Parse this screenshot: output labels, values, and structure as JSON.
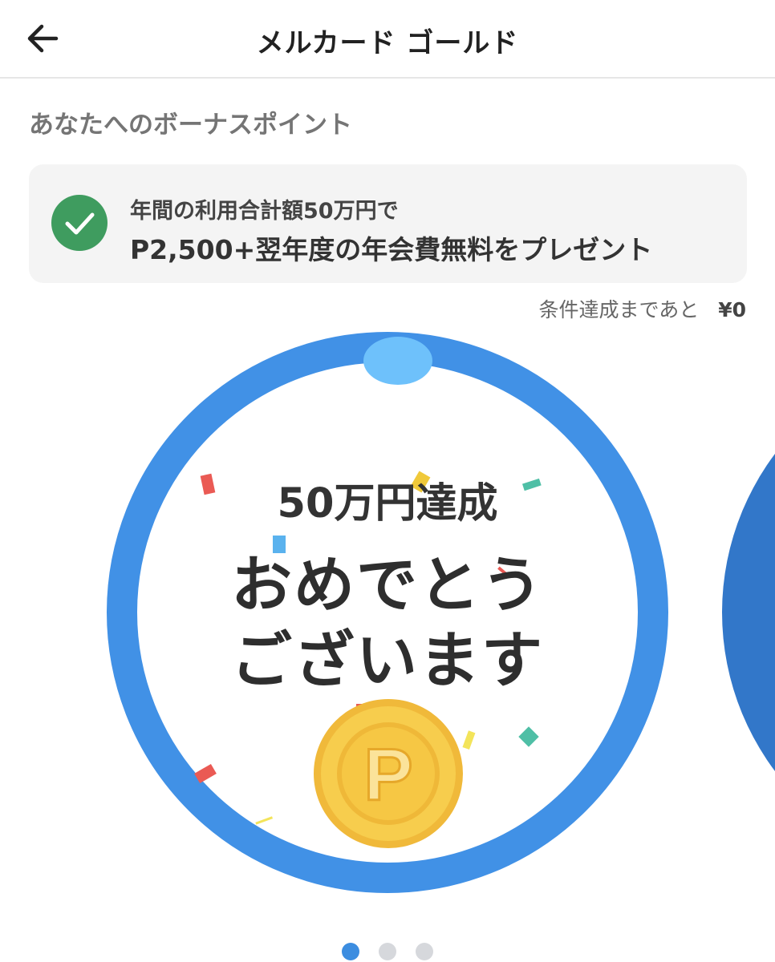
{
  "header": {
    "title": "メルカード ゴールド",
    "back_icon": "arrow-left-icon"
  },
  "section": {
    "title": "あなたへのボーナスポイント"
  },
  "bonus": {
    "status_icon": "check-circle-icon",
    "line1": "年間の利用合計額50万円で",
    "line2": "P2,500+翌年度の年会費無料をプレゼント"
  },
  "progress": {
    "remaining_label": "条件達成まであと",
    "remaining_amount": "¥0",
    "fraction": 1.0
  },
  "celebration": {
    "achieved_label": "50万円達成",
    "message_line1": "おめでとう",
    "message_line2": "ございます",
    "coin_icon": "point-coin-icon",
    "coin_letter": "P"
  },
  "carousel": {
    "page_count": 3,
    "active_index": 0
  },
  "colors": {
    "ring": "#4191e6",
    "ring_knob": "#6ec1fb",
    "check_green": "#3f9c5f",
    "coin_gold": "#f5c542",
    "next_card": "#3277c9",
    "dot_active": "#3c8de0",
    "dot_inactive": "#d6d8dc"
  }
}
